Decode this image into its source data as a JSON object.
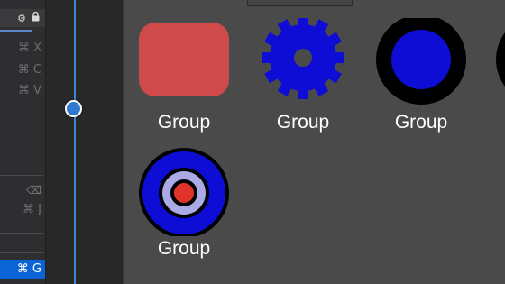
{
  "menu": {
    "top_icons": [
      "gear-icon",
      "lock-icon"
    ],
    "shortcuts": [
      {
        "text": "⌘ X"
      },
      {
        "text": "⌘ C"
      },
      {
        "text": "⌘ V"
      },
      {
        "text": "⌫"
      },
      {
        "text": "⌘ J"
      },
      {
        "text": "⌘ G",
        "selected": true
      }
    ]
  },
  "library": {
    "items": [
      {
        "label": "Group",
        "shape": "rounded-square",
        "color": "#cf4a4a"
      },
      {
        "label": "Group",
        "shape": "gear",
        "color": "#0d0dd6"
      },
      {
        "label": "Group",
        "shape": "ring",
        "color": "#0d0dd6"
      },
      {
        "label": "Group",
        "shape": "target",
        "color": "#0d0dd6"
      }
    ]
  },
  "colors": {
    "accent": "#0a64d6",
    "timeline": "#3c86d8",
    "blue_shape": "#0d0dd6",
    "red_shape": "#cf4a4a",
    "target_center": "#e0342b"
  }
}
